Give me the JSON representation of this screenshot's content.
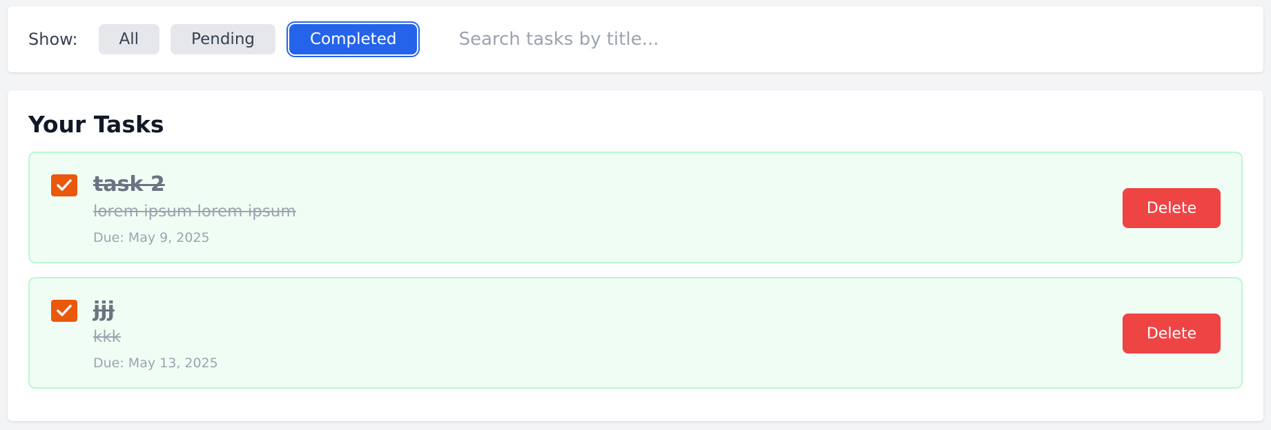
{
  "filter": {
    "label": "Show:",
    "buttons": [
      {
        "label": "All",
        "active": false
      },
      {
        "label": "Pending",
        "active": false
      },
      {
        "label": "Completed",
        "active": true
      }
    ],
    "search": {
      "placeholder": "Search tasks by title...",
      "value": ""
    }
  },
  "tasks": {
    "title": "Your Tasks",
    "items": [
      {
        "title": "task 2",
        "description": "lorem ipsum lorem ipsum",
        "due": "Due: May 9, 2025",
        "completed": true,
        "delete_label": "Delete"
      },
      {
        "title": "jjj",
        "description": "kkk",
        "due": "Due: May 13, 2025",
        "completed": true,
        "delete_label": "Delete"
      }
    ]
  },
  "colors": {
    "accent": "#2563eb",
    "checkbox": "#ea580c",
    "delete": "#ef4444",
    "card_bg": "#f0fdf4",
    "card_border": "#bbf7d0"
  },
  "icons": {
    "checkbox": "check-icon"
  }
}
